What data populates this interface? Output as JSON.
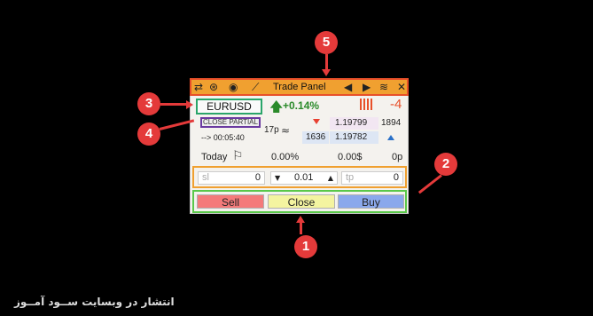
{
  "panel": {
    "title": "Trade Panel",
    "symbol": "EURUSD",
    "daily_change": "+0.14%",
    "position_count": "-4",
    "close_partial": "CLOSE PARTIAL",
    "timer": "--> 00:05:40",
    "spread": "17p",
    "bid": "1.19799",
    "bid_volume": "1894",
    "ask_volume": "1636",
    "ask": "1.19782",
    "today_label": "Today",
    "today_percent": "0.00%",
    "today_money": "0.00$",
    "today_pips": "0p",
    "sl_placeholder": "sl",
    "sl_value": "0",
    "lot_value": "0.01",
    "tp_placeholder": "tp",
    "tp_value": "0",
    "sell_label": "Sell",
    "close_label": "Close",
    "buy_label": "Buy"
  },
  "callouts": {
    "one": "1",
    "two": "2",
    "three": "3",
    "four": "4",
    "five": "5"
  },
  "watermark": "انتشار در وبسایت ســود آمــوز",
  "colors": {
    "titlebar": "#f0a030",
    "callout": "#e43a3a",
    "sell": "#f47a7a",
    "close": "#f4f4a0",
    "buy": "#8aa8ec",
    "symbol_border": "#2aa56a",
    "partial_border": "#6a3aa0",
    "inputs_border": "#f0a030",
    "buttons_border": "#5ac84a"
  },
  "icons": [
    "arrows-swap-icon",
    "help-icon",
    "eye-icon",
    "ruler-icon",
    "triangle-left-icon",
    "triangle-right-icon",
    "wave-hand-icon",
    "close-icon",
    "up-arrow-icon",
    "bars-icon",
    "flag-icon",
    "wave-icon"
  ]
}
